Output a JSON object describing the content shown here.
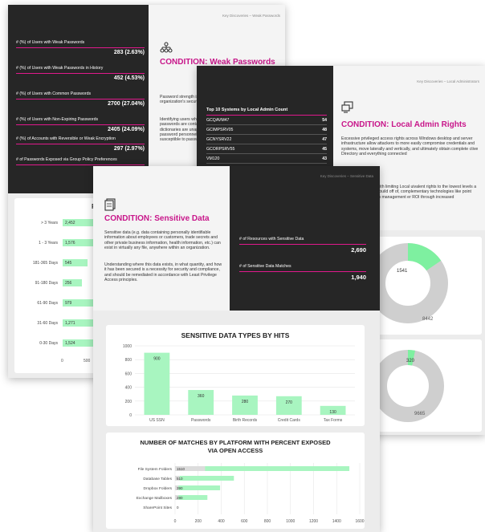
{
  "colors": {
    "accent": "#c8168a",
    "rule": "#e0198c",
    "bar": "#a8f5c0",
    "donut_main": "#cfcfcf",
    "donut_slice": "#7ef0a0"
  },
  "page1": {
    "stats": [
      {
        "label": "# (%) of Users with Weak Passwords",
        "value": "283 (2.63%)"
      },
      {
        "label": "# (%) of Users with Weak Passwords in History",
        "value": "452 (4.53%)"
      },
      {
        "label": "# (%) of Users with Common Passwords",
        "value": "2700 (27.04%)"
      },
      {
        "label": "# (%) of Users with Non-Expiring Passwords",
        "value": "2405 (24.09%)"
      },
      {
        "label": "# (%) of Accounts with Reversible or Weak Encryption",
        "value": "297 (2.97%)"
      },
      {
        "label": "# of Passwords Exposed via Group Policy Preferences",
        "value": ""
      }
    ],
    "header": "Key Discoveries – Weak Passwords",
    "condition_title": "CONDITION: Weak Passwords",
    "paragraph1": "Password strength is one of any organization's security strategy.",
    "paragraph2": "Identifying users whose passwords are contained in public dictionaries are unapproved password personnel to prevent susceptible to password guessing"
  },
  "page1_chart": {
    "title": "F",
    "categories": [
      "> 3 Years",
      "1 - 3 Years",
      "181-365 Days",
      "91-180 Days",
      "61-90 Days",
      "31-60 Days",
      "0-30 Days"
    ],
    "values": [
      2452,
      1576,
      545,
      256,
      979,
      1271,
      1524
    ],
    "value_labels": [
      "2,452",
      "1,576",
      "545",
      "256",
      "979",
      "1,271",
      "1,524"
    ],
    "ticks": [
      "0",
      "500"
    ]
  },
  "page2": {
    "header": "Key Discoveries – Local Administrators",
    "condition_title": "CONDITION: Local Admin Rights",
    "paragraph1": "Excessive privileged access rights across Windows desktop and server infrastructure allow attackers to more easily compromise credentials and systems, move laterally and vertically, and ultimately obtain complete ctive Directory and everything connected",
    "paragraph2": "evel security starts with limiting Local uivalent rights to the lowest levels a strong foundation to build off of, complementary technologies like point Protection, and patch management er ROI through increased effectiveness.",
    "table_title": "Top 10 Systems by Local Admin Count",
    "rows": [
      {
        "name": "GCQAVM47",
        "count": "54"
      },
      {
        "name": "GCIMPSRV05",
        "count": "48"
      },
      {
        "name": "GCNYSRV22",
        "count": "47"
      },
      {
        "name": "GCORPSRV55",
        "count": "45"
      },
      {
        "name": "VM120",
        "count": "43"
      }
    ],
    "donut1": {
      "small": "1541",
      "large": "8442"
    },
    "donut2": {
      "small": "320",
      "large": "9665"
    }
  },
  "page3": {
    "header": "Key Discoveries – Sensitive Data",
    "condition_title": "CONDITION: Sensitive Data",
    "paragraph1": "Sensitive data (e.g. data containing personally identifiable information about employees or customers, trade secrets and other private business information, health information, etc.) can exist in virtually any file, anywhere within an organization.",
    "paragraph2": "Understanding where this data exists, in what quantity, and how it has been secured is a necessity for security and compliance, and should be remediated in accordance with Least Privilege Access principles.",
    "stat1_label": "# of Resources with Sensitive Data",
    "stat1_value": "2,690",
    "stat2_label": "# of Sensitive Data Matches",
    "stat2_value": "1,940"
  },
  "chart_data": [
    {
      "type": "bar",
      "title": "SENSITIVE DATA TYPES BY HITS",
      "categories": [
        "US SSN",
        "Passwords",
        "Birth Records",
        "Credit Cards",
        "Tax Forms"
      ],
      "values": [
        900,
        360,
        280,
        270,
        130
      ],
      "ylim": [
        0,
        1000
      ],
      "yticks": [
        "0",
        "200",
        "400",
        "600",
        "800",
        "1000"
      ]
    },
    {
      "type": "bar",
      "orientation": "horizontal",
      "title": "NUMBER OF MATCHES BY PLATFORM WITH PERCENT EXPOSED VIA OPEN ACCESS",
      "categories": [
        "File System Folders",
        "Database Tables",
        "Dropbox Folders",
        "Exchange Mailboxes",
        "SharePoint Sites"
      ],
      "values": [
        1510,
        510,
        390,
        280,
        0
      ],
      "exposed": [
        260,
        40,
        30,
        30,
        0
      ],
      "xlim": [
        0,
        1600
      ],
      "xticks": [
        "0",
        "200",
        "400",
        "600",
        "800",
        "1000",
        "1200",
        "1400",
        "1600"
      ]
    }
  ]
}
